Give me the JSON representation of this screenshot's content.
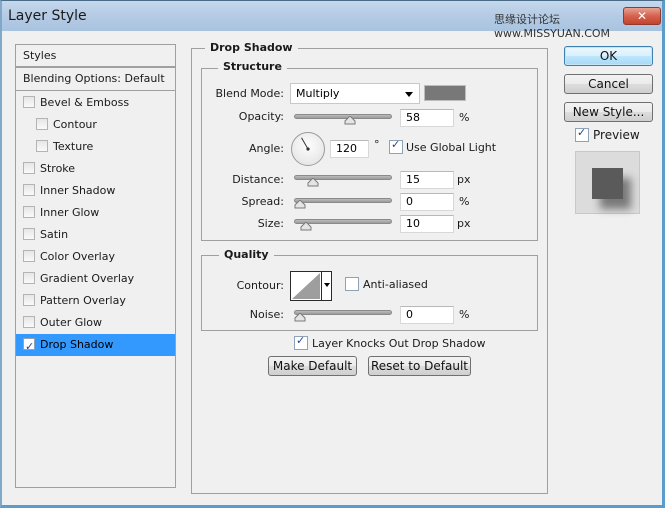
{
  "window": {
    "title": "Layer Style",
    "watermark": "思缘设计论坛 www.MISSYUAN.COM",
    "close_label": "✕"
  },
  "styles_panel": {
    "header": "Styles",
    "blending_options": "Blending Options: Default",
    "items": [
      {
        "label": "Bevel & Emboss",
        "checked": false,
        "sub": false,
        "selected": false
      },
      {
        "label": "Contour",
        "checked": false,
        "sub": true,
        "selected": false
      },
      {
        "label": "Texture",
        "checked": false,
        "sub": true,
        "selected": false
      },
      {
        "label": "Stroke",
        "checked": false,
        "sub": false,
        "selected": false
      },
      {
        "label": "Inner Shadow",
        "checked": false,
        "sub": false,
        "selected": false
      },
      {
        "label": "Inner Glow",
        "checked": false,
        "sub": false,
        "selected": false
      },
      {
        "label": "Satin",
        "checked": false,
        "sub": false,
        "selected": false
      },
      {
        "label": "Color Overlay",
        "checked": false,
        "sub": false,
        "selected": false
      },
      {
        "label": "Gradient Overlay",
        "checked": false,
        "sub": false,
        "selected": false
      },
      {
        "label": "Pattern Overlay",
        "checked": false,
        "sub": false,
        "selected": false
      },
      {
        "label": "Outer Glow",
        "checked": false,
        "sub": false,
        "selected": false
      },
      {
        "label": "Drop Shadow",
        "checked": true,
        "sub": false,
        "selected": true
      }
    ]
  },
  "drop_shadow": {
    "title": "Drop Shadow",
    "structure": {
      "title": "Structure",
      "blend_mode_label": "Blend Mode:",
      "blend_mode_value": "Multiply",
      "shadow_color": "#787878",
      "opacity_label": "Opacity:",
      "opacity_value": "58",
      "opacity_unit": "%",
      "opacity_fraction": 0.58,
      "angle_label": "Angle:",
      "angle_value": "120",
      "angle_unit": "°",
      "angle_degrees": 120,
      "use_global_light_label": "Use Global Light",
      "use_global_light": true,
      "distance_label": "Distance:",
      "distance_value": "15",
      "distance_unit": "px",
      "distance_fraction": 0.15,
      "spread_label": "Spread:",
      "spread_value": "0",
      "spread_unit": "%",
      "spread_fraction": 0,
      "size_label": "Size:",
      "size_value": "10",
      "size_unit": "px",
      "size_fraction": 0.07
    },
    "quality": {
      "title": "Quality",
      "contour_label": "Contour:",
      "anti_aliased_label": "Anti-aliased",
      "anti_aliased": false,
      "noise_label": "Noise:",
      "noise_value": "0",
      "noise_unit": "%",
      "noise_fraction": 0
    },
    "layer_knocks_out_label": "Layer Knocks Out Drop Shadow",
    "layer_knocks_out": true,
    "make_default_label": "Make Default",
    "reset_default_label": "Reset to Default"
  },
  "actions": {
    "ok_label": "OK",
    "cancel_label": "Cancel",
    "new_style_label": "New Style...",
    "preview_label": "Preview",
    "preview_checked": true
  }
}
